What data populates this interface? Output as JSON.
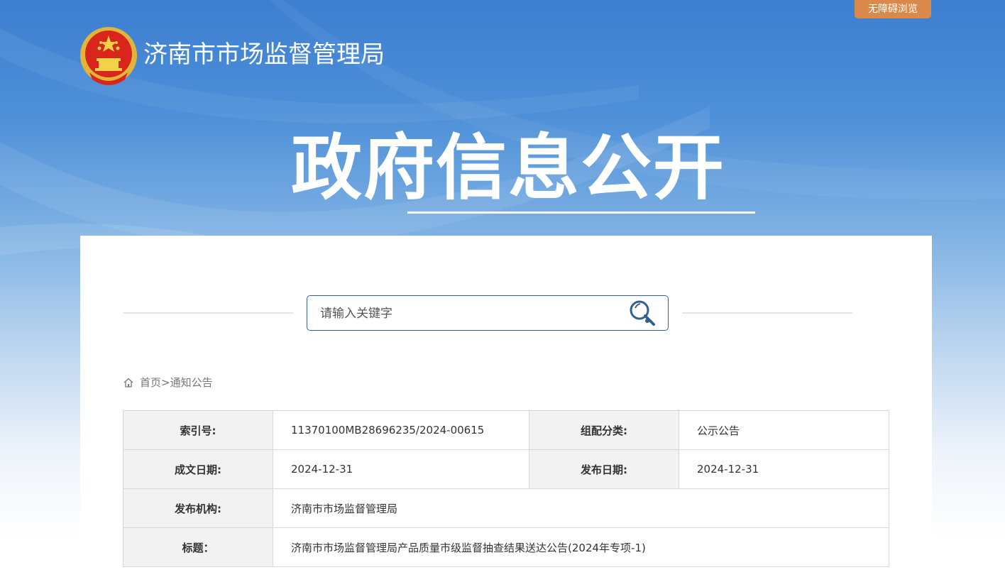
{
  "header": {
    "accessibility_label": "无障碍浏览",
    "site_title": "济南市市场监督管理局",
    "hero_title": "政府信息公开"
  },
  "search": {
    "placeholder": "请输入关键字"
  },
  "breadcrumb": {
    "home": "首页",
    "separator": ">",
    "current": "通知公告"
  },
  "info": {
    "index_label": "索引号:",
    "index_value": "11370100MB28696235/2024-00615",
    "category_label": "组配分类:",
    "category_value": "公示公告",
    "created_label": "成文日期:",
    "created_value": "2024-12-31",
    "published_label": "发布日期:",
    "published_value": "2024-12-31",
    "org_label": "发布机构:",
    "org_value": "济南市市场监督管理局",
    "title_label": "标题：",
    "title_value": "济南市市场监督管理局产品质量市级监督抽查结果送达公告(2024年专项-1)"
  },
  "colors": {
    "accent_orange": "#d98a4b",
    "search_border": "#34608e",
    "header_blue": "#3d7fd0"
  }
}
